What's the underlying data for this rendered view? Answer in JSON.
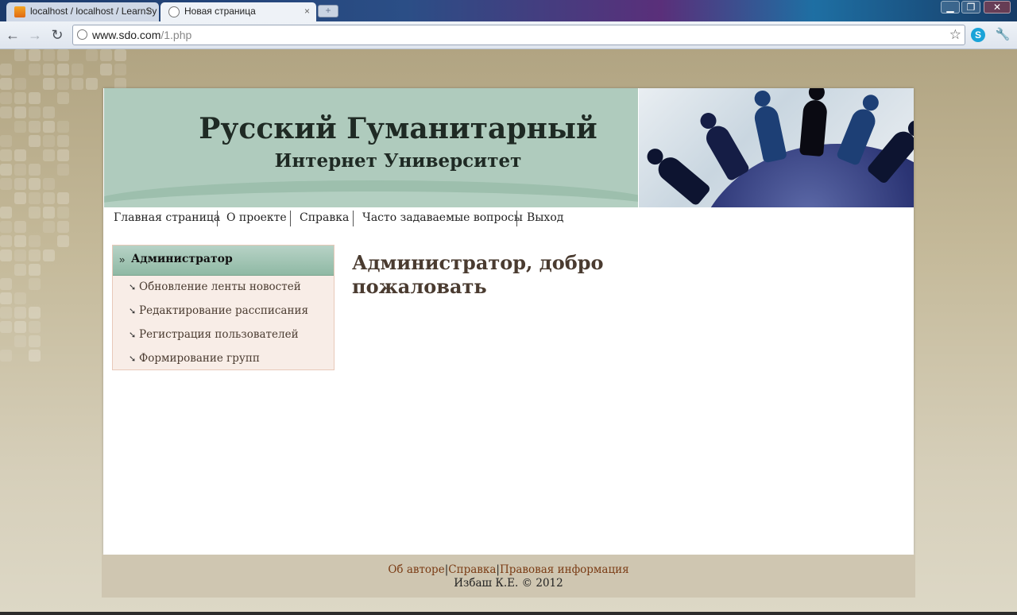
{
  "browser": {
    "tabs": [
      {
        "title": "localhost / localhost / LearnSy"
      },
      {
        "title": "Новая страница"
      }
    ],
    "close_glyph": "×",
    "new_tab_glyph": "+",
    "window_buttons": {
      "minimize": "▁",
      "restore": "❐",
      "close": "✕"
    },
    "nav": {
      "back": "←",
      "forward": "→",
      "reload": "↻"
    },
    "url": {
      "host": "www.sdo.com",
      "path": "/1.php"
    },
    "bookmark_glyph": "☆",
    "wrench_glyph": "🔧",
    "extension_glyph": "S"
  },
  "site": {
    "title": "Русский Гуманитарный",
    "subtitle": "Интернет Университет"
  },
  "nav": {
    "items": [
      "Главная страница",
      "О проекте",
      "Справка",
      "Часто задаваемые вопросы",
      "Выход"
    ]
  },
  "sidebar": {
    "title": "Администратор",
    "chevron": "»",
    "arrow": "➘",
    "items": [
      "Обновление ленты новостей",
      "Редактирование рассписания",
      "Регистрация пользователей",
      "Формирование групп"
    ]
  },
  "main": {
    "welcome": "Администратор, добро пожаловать"
  },
  "footer": {
    "links": [
      "Об авторе",
      "Справка",
      "Правовая информация"
    ],
    "separator": "|",
    "copyright": "Избаш К.Е. © 2012"
  },
  "colors": {
    "header_green": "#afcbbd",
    "sidebar_bg": "#f8ede7",
    "text_brown": "#4a3b30",
    "footer_link": "#7a3b14",
    "footer_bg": "#cfc6b1"
  }
}
